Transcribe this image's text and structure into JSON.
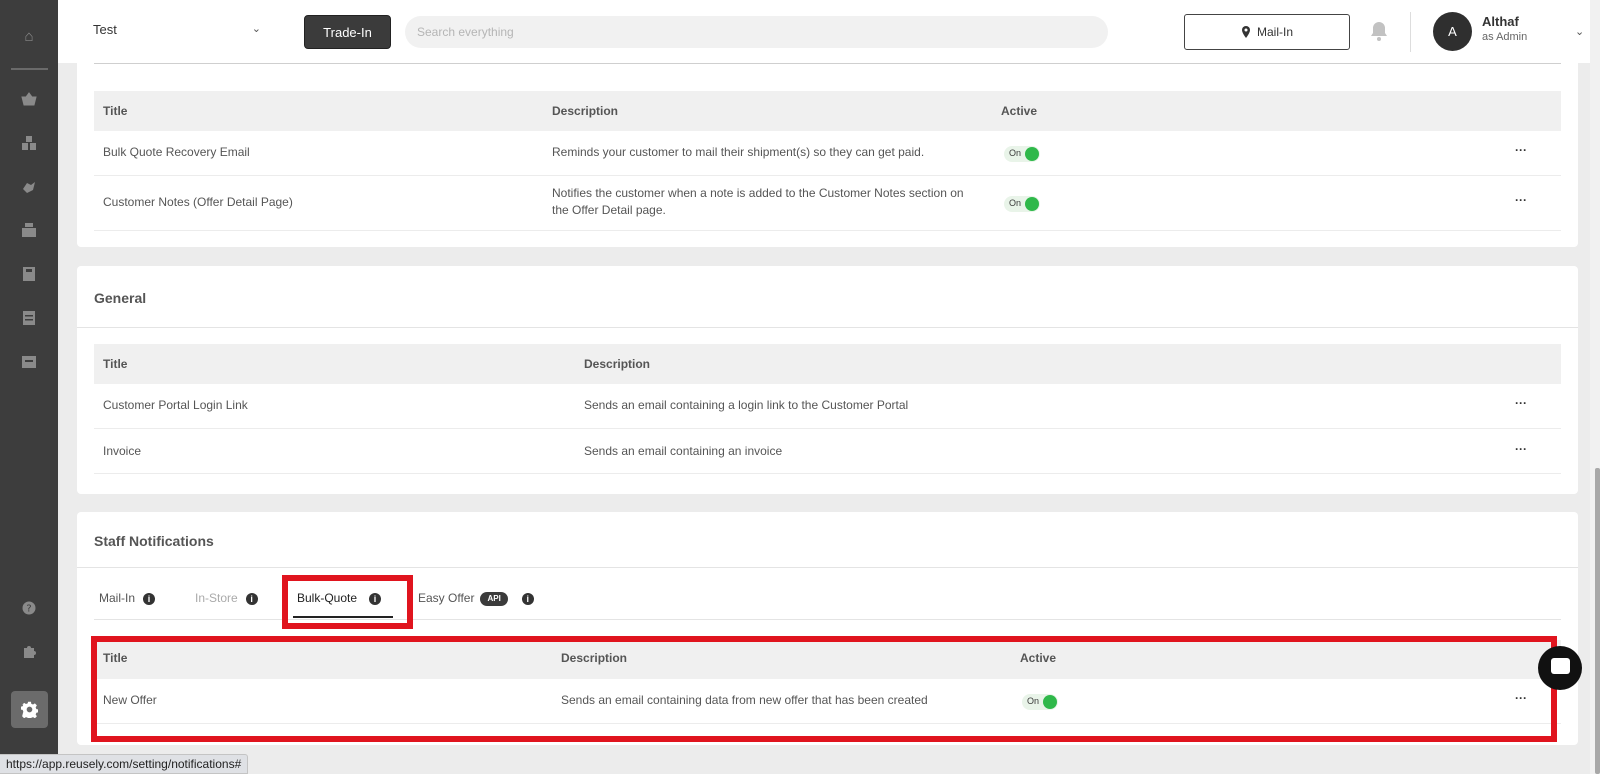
{
  "topbar": {
    "store": "Test",
    "trade_in_label": "Trade-In",
    "search_placeholder": "Search everything",
    "mail_in_label": "Mail-In",
    "avatar_initial": "A",
    "user_name": "Althaf",
    "user_role": "as Admin"
  },
  "sidebar": {
    "icons": [
      "home-icon",
      "basket-icon",
      "boxes-icon",
      "hand-icon",
      "inventory-icon",
      "store-icon",
      "report-icon",
      "archive-icon",
      "help-icon",
      "puzzle-icon",
      "gear-icon"
    ]
  },
  "bulk_quote_customer": {
    "columns": [
      "Title",
      "Description",
      "Active"
    ],
    "rows": [
      {
        "title": "Bulk Quote Recovery Email",
        "description": "Reminds your customer to mail their shipment(s) so they can get paid.",
        "active": "On"
      },
      {
        "title": "Customer Notes (Offer Detail Page)",
        "description_line1": "Notifies the customer when a note is added to the Customer Notes section on",
        "description_line2": "the Offer Detail page.",
        "active": "On"
      }
    ]
  },
  "general": {
    "title": "General",
    "columns": [
      "Title",
      "Description"
    ],
    "rows": [
      {
        "title": "Customer Portal Login Link",
        "description": "Sends an email containing a login link to the Customer Portal"
      },
      {
        "title": "Invoice",
        "description": "Sends an email containing an invoice"
      }
    ]
  },
  "staff": {
    "title": "Staff Notifications",
    "tabs": [
      {
        "label": "Mail-In"
      },
      {
        "label": "In-Store"
      },
      {
        "label": "Bulk-Quote"
      },
      {
        "label": "Easy Offer",
        "badge": "API"
      }
    ],
    "active_tab": "Bulk-Quote",
    "columns": [
      "Title",
      "Description",
      "Active"
    ],
    "rows": [
      {
        "title": "New Offer",
        "description": "Sends an email containing data from new offer that has been created",
        "active": "On"
      }
    ]
  },
  "status_url": "https://app.reusely.com/setting/notifications#",
  "colors": {
    "highlight": "#e0141e",
    "toggle_on": "#2fb84a",
    "sidebar": "#3d3d3d"
  }
}
